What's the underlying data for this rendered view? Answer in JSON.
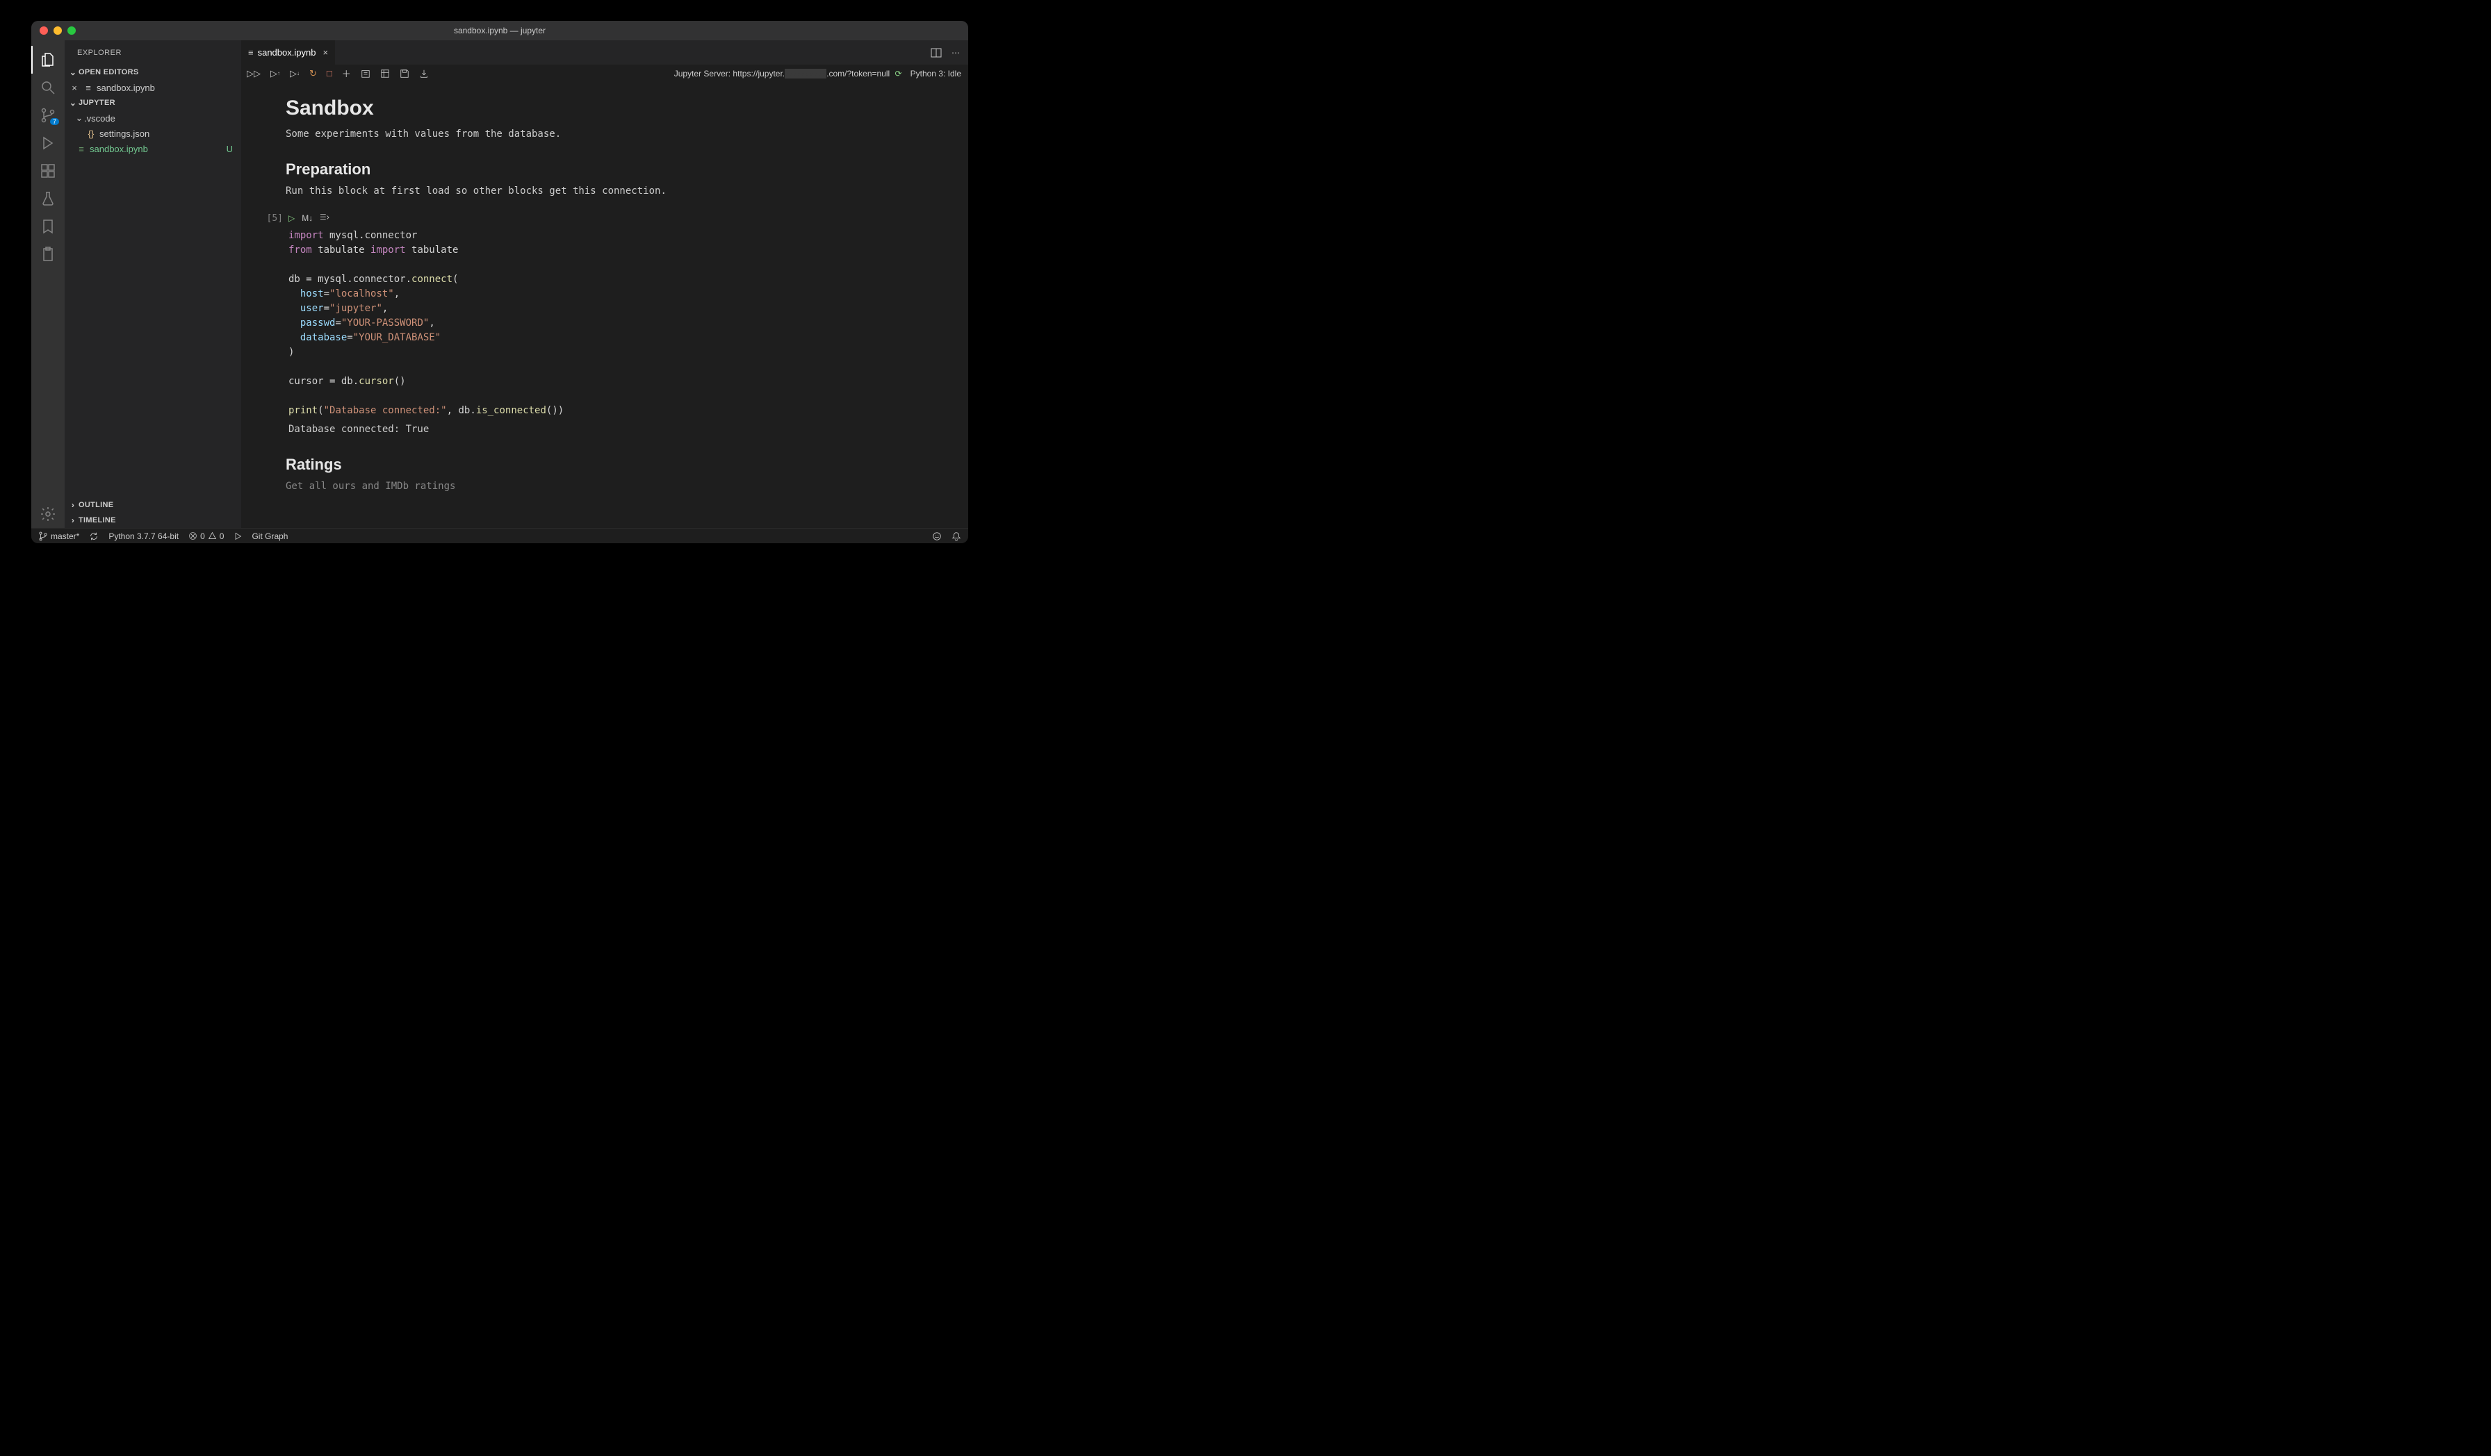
{
  "window": {
    "title": "sandbox.ipynb — jupyter"
  },
  "sidebar": {
    "title": "EXPLORER",
    "open_editors_label": "OPEN EDITORS",
    "open_editors": [
      {
        "name": "sandbox.ipynb"
      }
    ],
    "workspace_label": "JUPYTER",
    "tree": {
      "folder_vscode": ".vscode",
      "settings_json": "settings.json",
      "sandbox_ipynb": "sandbox.ipynb",
      "sandbox_status": "U"
    },
    "outline_label": "OUTLINE",
    "timeline_label": "TIMELINE"
  },
  "activity": {
    "scm_badge": "7"
  },
  "tabs": {
    "active": "sandbox.ipynb"
  },
  "notebook_toolbar": {
    "server_label": "Jupyter Server: https://jupyter.",
    "server_suffix": ".com/?token=null",
    "kernel": "Python 3: Idle"
  },
  "notebook": {
    "h1": "Sandbox",
    "intro": "Some experiments with values from the database.",
    "h2_prep": "Preparation",
    "prep_desc": "Run this block at first load so other blocks get this connection.",
    "exec_count": "[5]",
    "code": {
      "l1_kw": "import",
      "l1_rest": " mysql.connector",
      "l2_kw1": "from",
      "l2_mid": " tabulate ",
      "l2_kw2": "import",
      "l2_rest": " tabulate",
      "l4": "db = mysql.connector.",
      "l4_fn": "connect",
      "l4_end": "(",
      "l5_arg": "host",
      "l5_eq": "=",
      "l5_str": "\"localhost\"",
      "l5_end": ",",
      "l6_arg": "user",
      "l6_eq": "=",
      "l6_str": "\"jupyter\"",
      "l6_end": ",",
      "l7_arg": "passwd",
      "l7_eq": "=",
      "l7_str": "\"YOUR-PASSWORD\"",
      "l7_end": ",",
      "l8_arg": "database",
      "l8_eq": "=",
      "l8_str": "\"YOUR_DATABASE\"",
      "l9": ")",
      "l11a": "cursor = db.",
      "l11_fn": "cursor",
      "l11b": "()",
      "l13_fn": "print",
      "l13a": "(",
      "l13_str": "\"Database connected:\"",
      "l13b": ", db.",
      "l13_fn2": "is_connected",
      "l13c": "())"
    },
    "output": "Database connected: True",
    "h2_ratings": "Ratings",
    "ratings_desc": "Get all ours and IMDb ratings"
  },
  "statusbar": {
    "branch": "master*",
    "python": "Python 3.7.7 64-bit",
    "errors": "0",
    "warnings": "0",
    "git_graph": "Git Graph"
  }
}
